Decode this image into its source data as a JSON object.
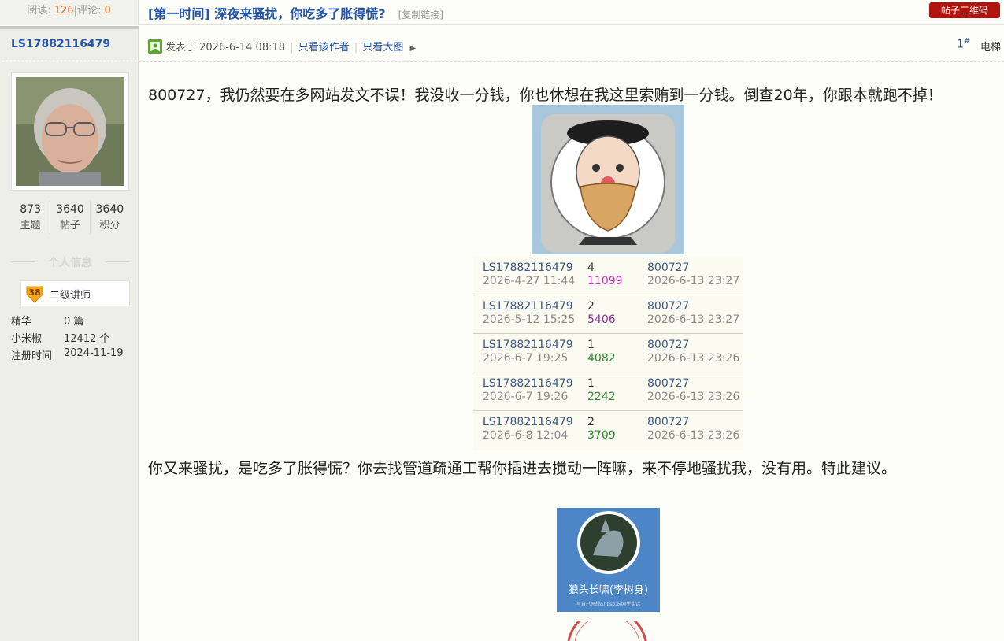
{
  "topbar": {
    "read_label": "阅读:",
    "read_count": "126",
    "comment_label": "评论:",
    "comment_count": "0",
    "title": "[第一时间] 深夜来骚扰，你吃多了胀得慌?",
    "copy_link": "[复制链接]",
    "qr_button": "帖子二维码"
  },
  "author": {
    "name": "LS17882116479",
    "stats": [
      {
        "value": "873",
        "label": "主题"
      },
      {
        "value": "3640",
        "label": "帖子"
      },
      {
        "value": "3640",
        "label": "积分"
      }
    ],
    "section_title": "个人信息",
    "level": "38",
    "rank_name": "二级讲师",
    "info": [
      {
        "key": "精华",
        "value": "0 篇"
      },
      {
        "key": "小米椒",
        "value": "12412 个"
      },
      {
        "key": "注册时间",
        "value": "2024-11-19"
      }
    ]
  },
  "post": {
    "posted_label": "发表于 2026-6-14 08:18",
    "only_author": "只看该作者",
    "large_image": "只看大图",
    "floor": "1",
    "floor_mark": "#",
    "elevator": "电梯",
    "paragraph1": "800727，我仍然要在多网站发文不误！我没收一分钱，你也休想在我这里索贿到一分钱。倒查20年，你跟本就跑不掉！",
    "paragraph2": "你又来骚扰，是吃多了胀得慌？你去找管道疏通工帮你插进去搅动一阵嘛，来不停地骚扰我，没有用。特此建议。",
    "table_rows": [
      {
        "user": "LS17882116479",
        "date": "2026-4-27 11:44",
        "num": "4",
        "views": "11099",
        "views_color": "#cc33cc",
        "target": "800727",
        "target_date": "2026-6-13 23:27"
      },
      {
        "user": "LS17882116479",
        "date": "2026-5-12 15:25",
        "num": "2",
        "views": "5406",
        "views_color": "#8a2b9a",
        "target": "800727",
        "target_date": "2026-6-13 23:27"
      },
      {
        "user": "LS17882116479",
        "date": "2026-6-7 19:25",
        "num": "1",
        "views": "4082",
        "views_color": "#2f8a2f",
        "target": "800727",
        "target_date": "2026-6-13 23:26"
      },
      {
        "user": "LS17882116479",
        "date": "2026-6-7 19:26",
        "num": "1",
        "views": "2242",
        "views_color": "#2f8a2f",
        "target": "800727",
        "target_date": "2026-6-13 23:26"
      },
      {
        "user": "LS17882116479",
        "date": "2026-6-8 12:04",
        "num": "2",
        "views": "3709",
        "views_color": "#2f8a2f",
        "target": "800727",
        "target_date": "2026-6-13 23:26"
      }
    ],
    "image3_caption": "狼头长啸(李树身)",
    "image3_sub": "写自己思想&nbsp;说网生实话"
  },
  "colors": {
    "link": "#2455a8",
    "accent": "#b1130f",
    "count": "#e06a23"
  }
}
